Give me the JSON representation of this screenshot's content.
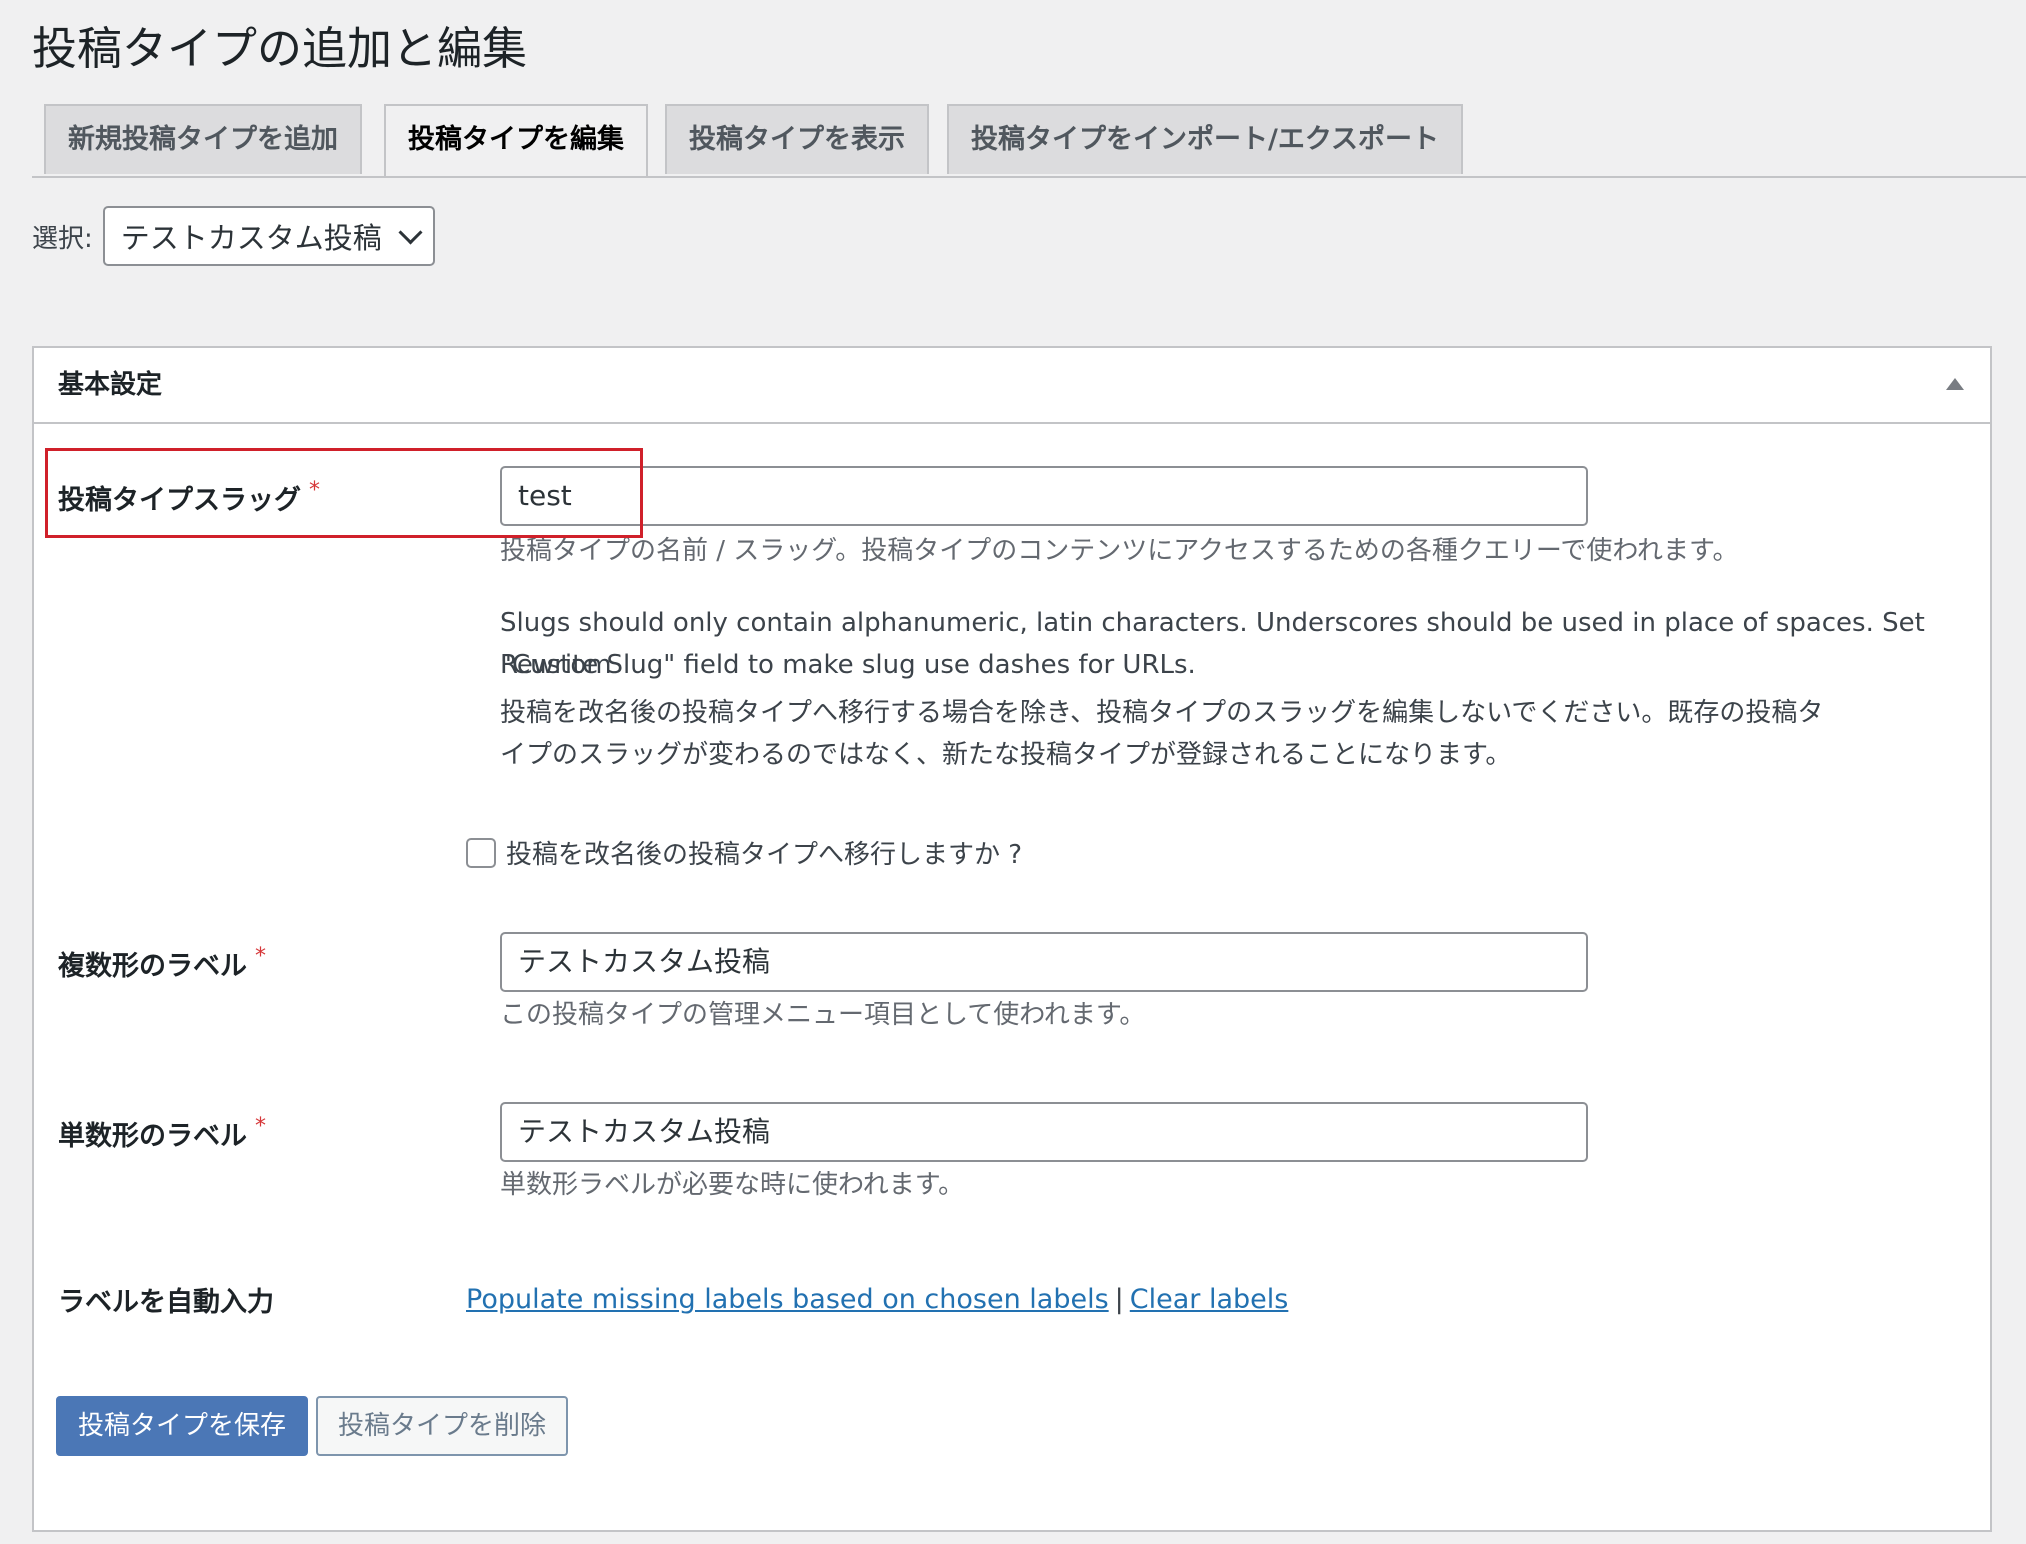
{
  "page": {
    "title": "投稿タイプの追加と編集"
  },
  "tabs": [
    {
      "label": "新規投稿タイプを追加",
      "active": false
    },
    {
      "label": "投稿タイプを編集",
      "active": true
    },
    {
      "label": "投稿タイプを表示",
      "active": false
    },
    {
      "label": "投稿タイプをインポート/エクスポート",
      "active": false
    }
  ],
  "selector": {
    "label": "選択:",
    "value": "テストカスタム投稿"
  },
  "panel": {
    "title": "基本設定",
    "slug": {
      "label": "投稿タイプスラッグ",
      "required": "*",
      "value": "test",
      "desc1": "投稿タイプの名前 / スラッグ。投稿タイプのコンテンツにアクセスするための各種クエリーで使われます。",
      "desc2_line1": "Slugs should only contain alphanumeric, latin characters. Underscores should be used in place of spaces. Set \"Custom",
      "desc2_line2": "Rewrite Slug\" field to make slug use dashes for URLs.",
      "desc3_line1": "投稿を改名後の投稿タイプへ移行する場合を除き、投稿タイプのスラッグを編集しないでください。既存の投稿タ",
      "desc3_line2": "イプのスラッグが変わるのではなく、新たな投稿タイプが登録されることになります。",
      "migrate_label": "投稿を改名後の投稿タイプへ移行しますか ?"
    },
    "plural": {
      "label": "複数形のラベル",
      "required": "*",
      "value": "テストカスタム投稿",
      "desc": "この投稿タイプの管理メニュー項目として使われます。"
    },
    "singular": {
      "label": "単数形のラベル",
      "required": "*",
      "value": "テストカスタム投稿",
      "desc": "単数形ラベルが必要な時に使われます。"
    },
    "autofill": {
      "label": "ラベルを自動入力",
      "populate": "Populate missing labels based on chosen labels",
      "separator": "|",
      "clear": "Clear labels"
    }
  },
  "buttons": {
    "save": "投稿タイプを保存",
    "delete": "投稿タイプを削除"
  },
  "colors": {
    "primary": "#4b77b6",
    "link": "#2271b1",
    "required": "#d63638",
    "highlight": "#d0202a"
  }
}
